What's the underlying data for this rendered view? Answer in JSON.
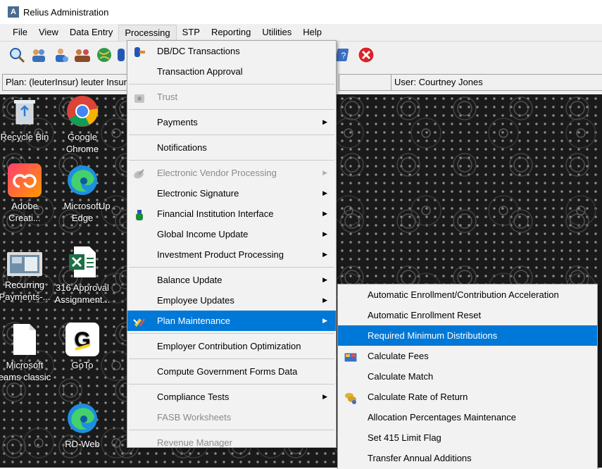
{
  "window": {
    "title": "Relius Administration",
    "app_icon_letter": "A"
  },
  "menubar": {
    "items": [
      "File",
      "View",
      "Data Entry",
      "Processing",
      "STP",
      "Reporting",
      "Utilities",
      "Help"
    ],
    "open_item": "Processing"
  },
  "status": {
    "plan": "Plan: (leuterInsur) leuter Insur",
    "user": "User: Courtney Jones"
  },
  "desktop": {
    "icons": [
      {
        "label": "Recycle Bin",
        "icon": "recycle-bin-icon"
      },
      {
        "label": "Google\nChrome",
        "icon": "chrome-icon"
      },
      {
        "label": "Adobe\nCreati...",
        "icon": "adobe-creative-cloud-icon"
      },
      {
        "label": "Microsoft\nEdge",
        "icon": "edge-icon"
      },
      {
        "label": "Up",
        "icon": "app-icon"
      },
      {
        "label": "Recurring\nPayments-...",
        "icon": "video-file-icon"
      },
      {
        "label": "316 Approval\nAssignment...",
        "icon": "excel-icon"
      },
      {
        "label": "Microsoft\neams classic",
        "icon": "document-icon"
      },
      {
        "label": "GoTo",
        "icon": "goto-icon"
      },
      {
        "label": "RD-Web",
        "icon": "edge-icon"
      }
    ]
  },
  "processing_menu": {
    "items": [
      {
        "label": "DB/DC Transactions",
        "enabled": true,
        "submenu": false,
        "icon": "db-dc-icon"
      },
      {
        "label": "Transaction Approval",
        "enabled": true,
        "submenu": false
      },
      {
        "label": "Trust",
        "enabled": false,
        "submenu": false,
        "icon": "trust-icon"
      },
      {
        "label": "Payments",
        "enabled": true,
        "submenu": true
      },
      {
        "label": "Notifications",
        "enabled": true,
        "submenu": false
      },
      {
        "label": "Electronic Vendor Processing",
        "enabled": false,
        "submenu": true,
        "icon": "satellite-icon"
      },
      {
        "label": "Electronic Signature",
        "enabled": true,
        "submenu": true
      },
      {
        "label": "Financial Institution Interface",
        "enabled": true,
        "submenu": true,
        "icon": "bottle-icon"
      },
      {
        "label": "Global Income Update",
        "enabled": true,
        "submenu": true
      },
      {
        "label": "Investment Product Processing",
        "enabled": true,
        "submenu": true
      },
      {
        "label": "Balance Update",
        "enabled": true,
        "submenu": true
      },
      {
        "label": "Employee Updates",
        "enabled": true,
        "submenu": true
      },
      {
        "label": "Plan Maintenance",
        "enabled": true,
        "submenu": true,
        "highlighted": true,
        "icon": "plan-maintenance-icon"
      },
      {
        "label": "Employer Contribution Optimization",
        "enabled": true,
        "submenu": false
      },
      {
        "label": "Compute Government Forms Data",
        "enabled": true,
        "submenu": false
      },
      {
        "label": "Compliance Tests",
        "enabled": true,
        "submenu": true
      },
      {
        "label": "FASB Worksheets",
        "enabled": false,
        "submenu": false
      },
      {
        "label": "Revenue Manager",
        "enabled": false,
        "submenu": false
      }
    ]
  },
  "plan_maintenance_submenu": {
    "items": [
      {
        "label": "Automatic Enrollment/Contribution Acceleration"
      },
      {
        "label": "Automatic Enrollment Reset"
      },
      {
        "label": "Required Minimum Distributions",
        "highlighted": true
      },
      {
        "label": "Calculate Fees",
        "icon": "calculate-fees-icon"
      },
      {
        "label": "Calculate Match"
      },
      {
        "label": "Calculate Rate of Return",
        "icon": "coins-icon"
      },
      {
        "label": "Allocation Percentages Maintenance"
      },
      {
        "label": "Set 415 Limit Flag"
      },
      {
        "label": "Transfer Annual Additions"
      }
    ]
  },
  "colors": {
    "highlight": "#0078d7",
    "menu_bg": "#f2f2f2",
    "disabled_text": "#8a8a8a"
  }
}
